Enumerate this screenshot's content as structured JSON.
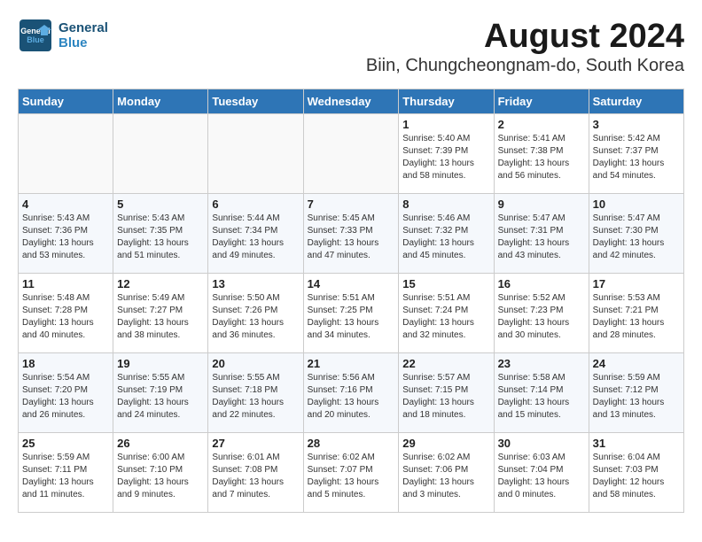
{
  "header": {
    "logo_line1": "General",
    "logo_line2": "Blue",
    "main_title": "August 2024",
    "sub_title": "Biin, Chungcheongnam-do, South Korea"
  },
  "days_of_week": [
    "Sunday",
    "Monday",
    "Tuesday",
    "Wednesday",
    "Thursday",
    "Friday",
    "Saturday"
  ],
  "weeks": [
    [
      {
        "num": "",
        "info": ""
      },
      {
        "num": "",
        "info": ""
      },
      {
        "num": "",
        "info": ""
      },
      {
        "num": "",
        "info": ""
      },
      {
        "num": "1",
        "info": "Sunrise: 5:40 AM\nSunset: 7:39 PM\nDaylight: 13 hours\nand 58 minutes."
      },
      {
        "num": "2",
        "info": "Sunrise: 5:41 AM\nSunset: 7:38 PM\nDaylight: 13 hours\nand 56 minutes."
      },
      {
        "num": "3",
        "info": "Sunrise: 5:42 AM\nSunset: 7:37 PM\nDaylight: 13 hours\nand 54 minutes."
      }
    ],
    [
      {
        "num": "4",
        "info": "Sunrise: 5:43 AM\nSunset: 7:36 PM\nDaylight: 13 hours\nand 53 minutes."
      },
      {
        "num": "5",
        "info": "Sunrise: 5:43 AM\nSunset: 7:35 PM\nDaylight: 13 hours\nand 51 minutes."
      },
      {
        "num": "6",
        "info": "Sunrise: 5:44 AM\nSunset: 7:34 PM\nDaylight: 13 hours\nand 49 minutes."
      },
      {
        "num": "7",
        "info": "Sunrise: 5:45 AM\nSunset: 7:33 PM\nDaylight: 13 hours\nand 47 minutes."
      },
      {
        "num": "8",
        "info": "Sunrise: 5:46 AM\nSunset: 7:32 PM\nDaylight: 13 hours\nand 45 minutes."
      },
      {
        "num": "9",
        "info": "Sunrise: 5:47 AM\nSunset: 7:31 PM\nDaylight: 13 hours\nand 43 minutes."
      },
      {
        "num": "10",
        "info": "Sunrise: 5:47 AM\nSunset: 7:30 PM\nDaylight: 13 hours\nand 42 minutes."
      }
    ],
    [
      {
        "num": "11",
        "info": "Sunrise: 5:48 AM\nSunset: 7:28 PM\nDaylight: 13 hours\nand 40 minutes."
      },
      {
        "num": "12",
        "info": "Sunrise: 5:49 AM\nSunset: 7:27 PM\nDaylight: 13 hours\nand 38 minutes."
      },
      {
        "num": "13",
        "info": "Sunrise: 5:50 AM\nSunset: 7:26 PM\nDaylight: 13 hours\nand 36 minutes."
      },
      {
        "num": "14",
        "info": "Sunrise: 5:51 AM\nSunset: 7:25 PM\nDaylight: 13 hours\nand 34 minutes."
      },
      {
        "num": "15",
        "info": "Sunrise: 5:51 AM\nSunset: 7:24 PM\nDaylight: 13 hours\nand 32 minutes."
      },
      {
        "num": "16",
        "info": "Sunrise: 5:52 AM\nSunset: 7:23 PM\nDaylight: 13 hours\nand 30 minutes."
      },
      {
        "num": "17",
        "info": "Sunrise: 5:53 AM\nSunset: 7:21 PM\nDaylight: 13 hours\nand 28 minutes."
      }
    ],
    [
      {
        "num": "18",
        "info": "Sunrise: 5:54 AM\nSunset: 7:20 PM\nDaylight: 13 hours\nand 26 minutes."
      },
      {
        "num": "19",
        "info": "Sunrise: 5:55 AM\nSunset: 7:19 PM\nDaylight: 13 hours\nand 24 minutes."
      },
      {
        "num": "20",
        "info": "Sunrise: 5:55 AM\nSunset: 7:18 PM\nDaylight: 13 hours\nand 22 minutes."
      },
      {
        "num": "21",
        "info": "Sunrise: 5:56 AM\nSunset: 7:16 PM\nDaylight: 13 hours\nand 20 minutes."
      },
      {
        "num": "22",
        "info": "Sunrise: 5:57 AM\nSunset: 7:15 PM\nDaylight: 13 hours\nand 18 minutes."
      },
      {
        "num": "23",
        "info": "Sunrise: 5:58 AM\nSunset: 7:14 PM\nDaylight: 13 hours\nand 15 minutes."
      },
      {
        "num": "24",
        "info": "Sunrise: 5:59 AM\nSunset: 7:12 PM\nDaylight: 13 hours\nand 13 minutes."
      }
    ],
    [
      {
        "num": "25",
        "info": "Sunrise: 5:59 AM\nSunset: 7:11 PM\nDaylight: 13 hours\nand 11 minutes."
      },
      {
        "num": "26",
        "info": "Sunrise: 6:00 AM\nSunset: 7:10 PM\nDaylight: 13 hours\nand 9 minutes."
      },
      {
        "num": "27",
        "info": "Sunrise: 6:01 AM\nSunset: 7:08 PM\nDaylight: 13 hours\nand 7 minutes."
      },
      {
        "num": "28",
        "info": "Sunrise: 6:02 AM\nSunset: 7:07 PM\nDaylight: 13 hours\nand 5 minutes."
      },
      {
        "num": "29",
        "info": "Sunrise: 6:02 AM\nSunset: 7:06 PM\nDaylight: 13 hours\nand 3 minutes."
      },
      {
        "num": "30",
        "info": "Sunrise: 6:03 AM\nSunset: 7:04 PM\nDaylight: 13 hours\nand 0 minutes."
      },
      {
        "num": "31",
        "info": "Sunrise: 6:04 AM\nSunset: 7:03 PM\nDaylight: 12 hours\nand 58 minutes."
      }
    ]
  ]
}
